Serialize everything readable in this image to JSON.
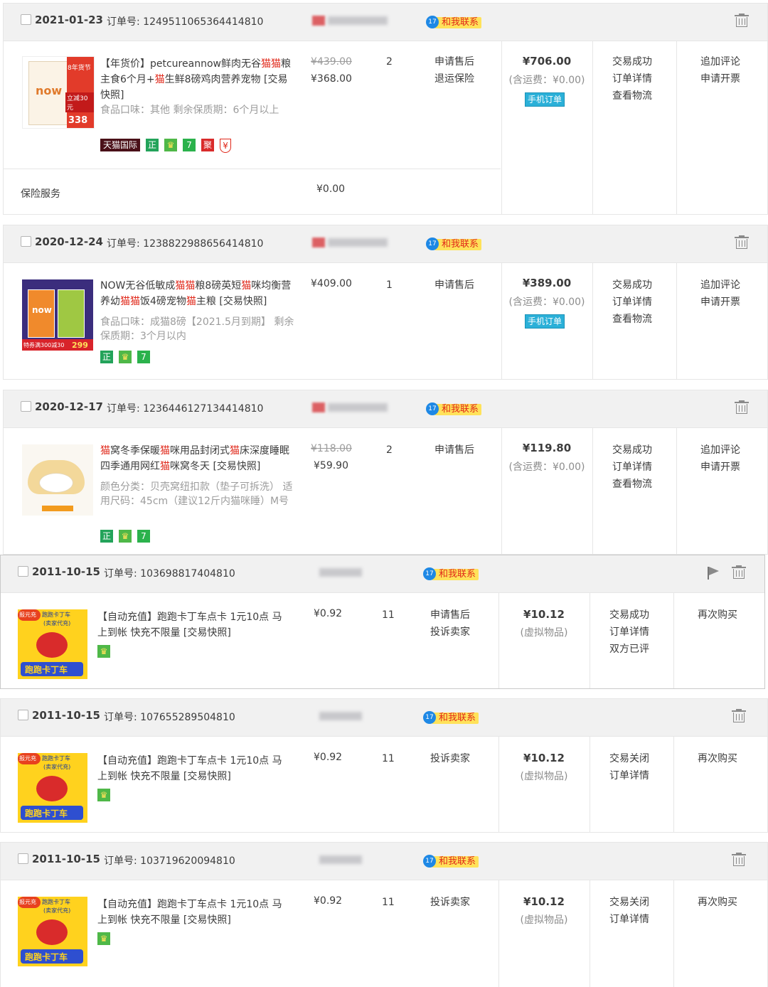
{
  "labels": {
    "order_no_prefix": "订单号: ",
    "contact": "和我联系",
    "contact_dot": "17",
    "mobile_order": "手机订单",
    "insurance_label": "保险服务",
    "insurance_price": "¥0.00"
  },
  "orders": [
    {
      "date": "2021-01-23",
      "order_no": "1249511065364414810",
      "title_parts": [
        "【年货价】petcureannow鲜肉无谷",
        "猫",
        "猫",
        "粮主食6个月+",
        "猫",
        "生鲜8磅鸡肉营养宠物 [交易快照]"
      ],
      "spec": "食品口味：其他  剩余保质期：6个月以上",
      "badges": [
        "天猫国际",
        "正",
        "♛",
        "7",
        "聚",
        "¥"
      ],
      "price_old": "¥439.00",
      "price": "¥368.00",
      "qty": "2",
      "actions": [
        "申请售后",
        "退运保险"
      ],
      "total": "¥706.00",
      "shipping": "(含运费：¥0.00)",
      "status_links": [
        "交易成功",
        "订单详情",
        "查看物流"
      ],
      "ops": [
        "追加评论",
        "申请开票"
      ],
      "thumb": {
        "tag1": "8年货节",
        "brand": "now",
        "tag2": "立减30元",
        "price": "338"
      }
    },
    {
      "date": "2020-12-24",
      "order_no": "1238822988656414810",
      "title_parts": [
        "NOW无谷低敏成",
        "猫",
        "猫",
        "粮8磅英短",
        "猫",
        "咪均衡营养幼",
        "猫",
        "猫",
        "饭4磅宠物",
        "猫",
        "主粮 [交易快照]"
      ],
      "spec": "食品口味：成猫8磅【2021.5月到期】 剩余保质期：3个月以内",
      "badges": [
        "正",
        "♛",
        "7"
      ],
      "price": "¥409.00",
      "qty": "1",
      "actions": [
        "申请售后"
      ],
      "total": "¥389.00",
      "shipping": "(含运费：¥0.00)",
      "status_links": [
        "交易成功",
        "订单详情",
        "查看物流"
      ],
      "ops": [
        "追加评论",
        "申请开票"
      ],
      "thumb": {
        "brand": "now",
        "tag1": "特券满300减30",
        "price": "299"
      }
    },
    {
      "date": "2020-12-17",
      "order_no": "1236446127134414810",
      "title_parts": [
        "猫",
        "窝冬季保暖",
        "猫",
        "咪用品封闭式",
        "猫",
        "床深度睡眠四季通用网红",
        "猫",
        "咪窝冬天 [交易快照]"
      ],
      "spec": "颜色分类：贝壳窝纽扣款（垫子可拆洗） 适用尺码：45cm（建议12斤内猫咪睡）M号",
      "badges": [
        "正",
        "♛",
        "7"
      ],
      "price_old": "¥118.00",
      "price": "¥59.90",
      "qty": "2",
      "actions": [
        "申请售后"
      ],
      "total": "¥119.80",
      "shipping": "(含运费：¥0.00)",
      "status_links": [
        "交易成功",
        "订单详情",
        "查看物流"
      ],
      "ops": [
        "追加评论",
        "申请开票"
      ]
    },
    {
      "date": "2011-10-15",
      "order_no": "103698817404810",
      "title": "【自动充值】跑跑卡丁车点卡 1元10点 马上到帐 快充不限量 [交易快照]",
      "badges": [
        "♛"
      ],
      "price": "¥0.92",
      "qty": "11",
      "actions": [
        "申请售后",
        "投诉卖家"
      ],
      "total": "¥10.12",
      "shipping": "(虚拟物品)",
      "status_links": [
        "交易成功",
        "订单详情",
        "双方已评"
      ],
      "ops": [
        "再次购买"
      ],
      "thumb": {
        "tag1": "报元充",
        "tag2": "跑跑卡丁车",
        "tag3": "(卖家代充)",
        "logo": "跑跑卡丁车"
      }
    },
    {
      "date": "2011-10-15",
      "order_no": "107655289504810",
      "title": "【自动充值】跑跑卡丁车点卡 1元10点 马上到帐 快充不限量 [交易快照]",
      "badges": [
        "♛"
      ],
      "price": "¥0.92",
      "qty": "11",
      "actions": [
        "投诉卖家"
      ],
      "total": "¥10.12",
      "shipping": "(虚拟物品)",
      "status_links": [
        "交易关闭",
        "订单详情"
      ],
      "ops": [
        "再次购买"
      ],
      "thumb": {
        "tag1": "报元充",
        "tag2": "跑跑卡丁车",
        "tag3": "(卖家代充)",
        "logo": "跑跑卡丁车"
      }
    },
    {
      "date": "2011-10-15",
      "order_no": "103719620094810",
      "title": "【自动充值】跑跑卡丁车点卡 1元10点 马上到帐 快充不限量 [交易快照]",
      "badges": [
        "♛"
      ],
      "price": "¥0.92",
      "qty": "11",
      "actions": [
        "投诉卖家"
      ],
      "total": "¥10.12",
      "shipping": "(虚拟物品)",
      "status_links": [
        "交易关闭",
        "订单详情"
      ],
      "ops": [
        "再次购买"
      ],
      "thumb": {
        "tag1": "报元充",
        "tag2": "跑跑卡丁车",
        "tag3": "(卖家代充)",
        "logo": "跑跑卡丁车"
      }
    }
  ],
  "colors": {
    "header_bg": "#f1f1f1",
    "keyword_red": "#e0281a",
    "contact_yellow": "#ffe25a",
    "mobile_blue": "#2bb0d8",
    "tmall_intl": "#b3112c",
    "zheng_green": "#23a35a",
    "seven_green": "#2bb24c",
    "ju_red": "#d92b2b"
  },
  "icons": [
    "trash-icon",
    "flag-icon",
    "contact-icon"
  ]
}
